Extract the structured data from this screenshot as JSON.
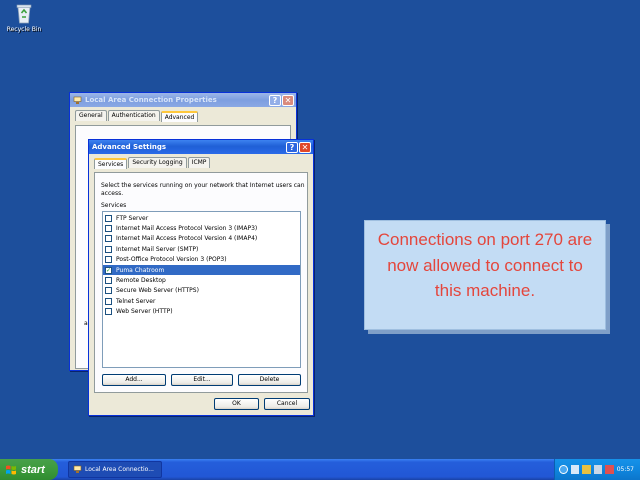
{
  "desktop": {
    "recycle_bin_label": "Recycle Bin"
  },
  "lac_window": {
    "title": "Local Area Connection Properties",
    "help_label": "?",
    "close_label": "✕",
    "tabs": [
      {
        "label": "General"
      },
      {
        "label": "Authentication"
      },
      {
        "label": "Advanced"
      }
    ],
    "partial_text": "a"
  },
  "adv_window": {
    "title": "Advanced Settings",
    "help_label": "?",
    "close_label": "✕",
    "tabs": [
      {
        "label": "Services"
      },
      {
        "label": "Security Logging"
      },
      {
        "label": "ICMP"
      }
    ],
    "description": "Select the services running on your network that Internet users can access.",
    "services_label": "Services",
    "services": [
      {
        "label": "FTP Server",
        "checked": false
      },
      {
        "label": "Internet Mail Access Protocol Version 3 (IMAP3)",
        "checked": false
      },
      {
        "label": "Internet Mail Access Protocol Version 4 (IMAP4)",
        "checked": false
      },
      {
        "label": "Internet Mail Server (SMTP)",
        "checked": false
      },
      {
        "label": "Post-Office Protocol Version 3 (POP3)",
        "checked": false
      },
      {
        "label": "Puma Chatroom",
        "checked": true
      },
      {
        "label": "Remote Desktop",
        "checked": false
      },
      {
        "label": "Secure Web Server (HTTPS)",
        "checked": false
      },
      {
        "label": "Telnet Server",
        "checked": false
      },
      {
        "label": "Web Server (HTTP)",
        "checked": false
      }
    ],
    "selected_index": 5,
    "add_label": "Add...",
    "edit_label": "Edit...",
    "delete_label": "Delete",
    "ok_label": "OK",
    "cancel_label": "Cancel"
  },
  "info_box": {
    "text": "Connections on port 270 are now allowed to connect to this machine."
  },
  "taskbar": {
    "start_label": "start",
    "task_label": "Local Area Connectio...",
    "clock": "05:57"
  },
  "colors": {
    "desktop": "#1d4f9c",
    "info_text": "#e4463c",
    "selection": "#316ac5"
  }
}
